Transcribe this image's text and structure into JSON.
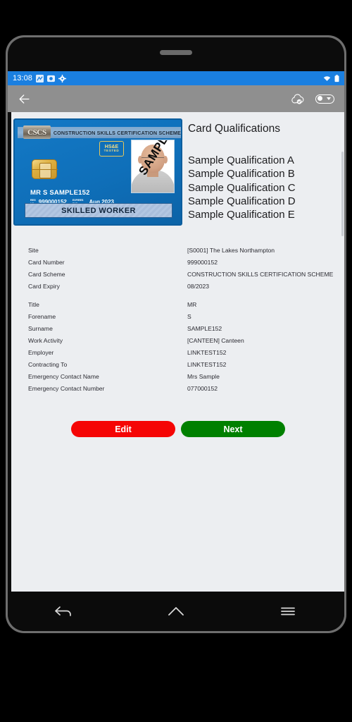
{
  "status_bar": {
    "time": "13:08",
    "left_icons": [
      "signal-chart-icon",
      "sync-icon",
      "settings-gear-icon"
    ],
    "right_icons": [
      "wifi-icon",
      "battery-icon"
    ],
    "background_color": "#1a7fe0"
  },
  "app_bar": {
    "back_icon": "back-arrow-icon",
    "cloud_icon": "cloud-check-icon",
    "toggle_label": "",
    "toggle_state": "off",
    "background_color": "#8f8f8f"
  },
  "card": {
    "logo_text": "CSCS",
    "scheme_banner": "CONSTRUCTION SKILLS CERTIFICATION SCHEME",
    "hse_line1": "HS&E",
    "hse_line2": "TESTED",
    "photo_watermark": "SAMPLE",
    "holder_name": "MR S SAMPLE152",
    "reg_label_line1": "REG",
    "reg_label_line2": "NO.",
    "reg_number": "999000152",
    "expiry_label_line1": "EXPIRES",
    "expiry_label_line2": "END",
    "expiry_value": "Aug 2023",
    "card_type_banner": "SKILLED WORKER"
  },
  "qualifications": {
    "title": "Card Qualifications",
    "items": [
      "Sample Qualification A",
      "Sample Qualification B",
      "Sample Qualification C",
      "Sample Qualification D",
      "Sample Qualification E"
    ]
  },
  "details": [
    {
      "label": "Site",
      "value": "[S0001] The Lakes Northampton",
      "group": 0
    },
    {
      "label": "Card Number",
      "value": "999000152",
      "group": 0
    },
    {
      "label": "Card Scheme",
      "value": "CONSTRUCTION SKILLS CERTIFICATION SCHEME",
      "group": 0
    },
    {
      "label": "Card Expiry",
      "value": "08/2023",
      "group": 0
    },
    {
      "label": "Title",
      "value": "MR",
      "group": 1
    },
    {
      "label": "Forename",
      "value": "S",
      "group": 1
    },
    {
      "label": "Surname",
      "value": "SAMPLE152",
      "group": 1
    },
    {
      "label": "Work Activity",
      "value": "[CANTEEN] Canteen",
      "group": 1
    },
    {
      "label": "Employer",
      "value": "LINKTEST152",
      "group": 1
    },
    {
      "label": "Contracting To",
      "value": "LINKTEST152",
      "group": 1
    },
    {
      "label": "Emergency Contact Name",
      "value": "Mrs Sample",
      "group": 1
    },
    {
      "label": "Emergency Contact Number",
      "value": "077000152",
      "group": 1
    }
  ],
  "buttons": {
    "edit_label": "Edit",
    "edit_color": "#f50505",
    "next_label": "Next",
    "next_color": "#008000"
  },
  "app_nav": {
    "items": [
      "recents-icon",
      "home-square-icon",
      "back-chevron-icon"
    ]
  },
  "system_nav": {
    "items": [
      "back-arrow-icon",
      "home-icon",
      "menu-icon"
    ]
  }
}
